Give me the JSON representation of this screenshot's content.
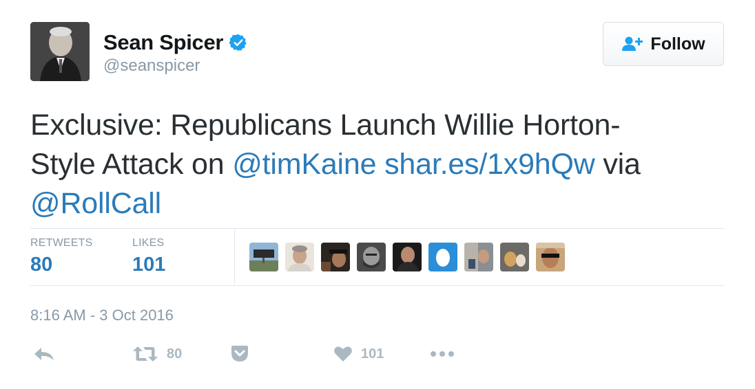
{
  "user": {
    "display_name": "Sean Spicer",
    "handle": "@seanspicer",
    "verified": true,
    "avatar_icon": "profile-photo"
  },
  "follow_button": {
    "label": "Follow",
    "icon": "add-user-icon"
  },
  "tweet": {
    "segments": [
      {
        "text": "Exclusive: Republicans Launch Willie Horton-",
        "link": false
      },
      {
        "text": "Style Attack on ",
        "link": false
      },
      {
        "text": "@timKaine",
        "link": true
      },
      {
        "text": " ",
        "link": false
      },
      {
        "text": "shar.es/1x9hQw",
        "link": true
      },
      {
        "text": " via ",
        "link": false
      },
      {
        "text": "@RollCall",
        "link": true
      }
    ]
  },
  "stats": {
    "retweets_label": "RETWEETS",
    "retweets_value": "80",
    "likes_label": "LIKES",
    "likes_value": "101"
  },
  "timestamp": "8:16 AM - 3 Oct 2016",
  "actions": {
    "reply_icon": "reply-icon",
    "retweet_icon": "retweet-icon",
    "retweet_count": "80",
    "pocket_icon": "pocket-icon",
    "like_icon": "heart-icon",
    "like_count": "101",
    "more_icon": "more-icon"
  },
  "colors": {
    "link": "#2b7bb9",
    "verified": "#1da1f2",
    "muted": "#8899a6",
    "action_gray": "#aab8c2",
    "text": "#292f33"
  }
}
